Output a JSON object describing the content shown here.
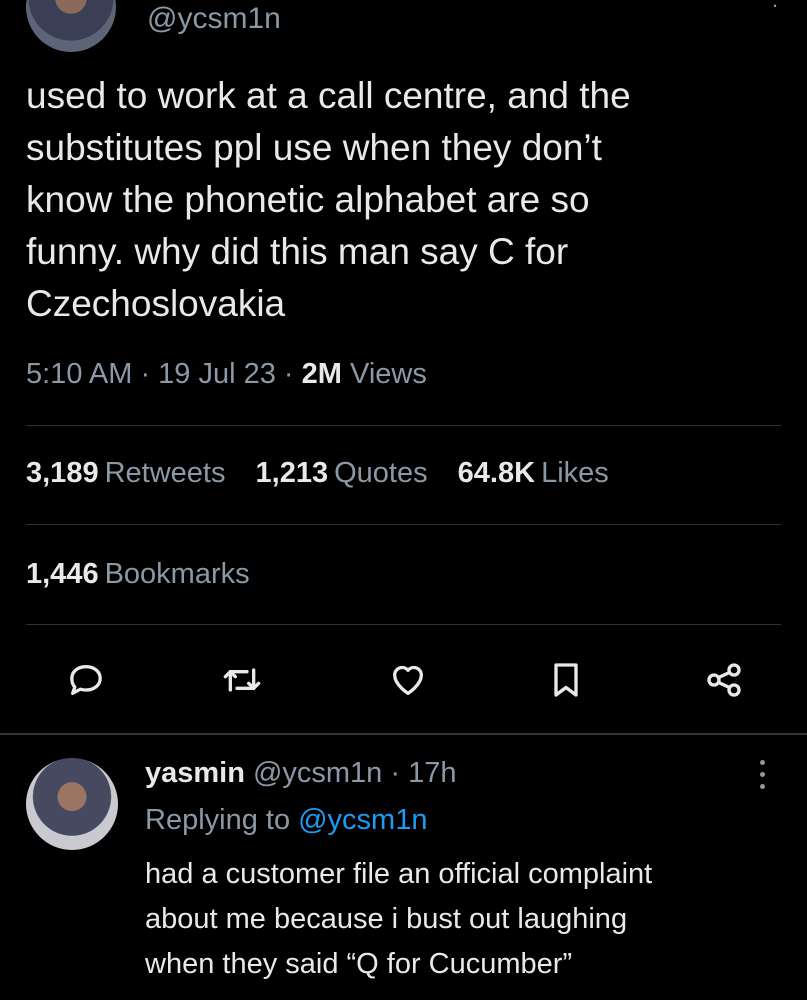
{
  "tweet": {
    "handle": "@ycsm1n",
    "text": "used to work at a call centre, and the\nsubstitutes ppl use when they don’t\nknow the phonetic alphabet are so\nfunny. why did this man say C for\nCzechoslovakia",
    "time": "5:10 AM · 19 Jul 23 · ",
    "views_count": "2M",
    "views_label": "Views"
  },
  "stats": {
    "retweets_count": "3,189",
    "retweets_label": "Retweets",
    "quotes_count": "1,213",
    "quotes_label": "Quotes",
    "likes_count": "64.8K",
    "likes_label": "Likes",
    "bookmarks_count": "1,446",
    "bookmarks_label": "Bookmarks"
  },
  "icons": {
    "reply": "reply-icon",
    "retweet": "retweet-icon",
    "like": "heart-icon",
    "bookmark": "bookmark-icon",
    "share": "share-icon"
  },
  "reply": {
    "name": "yasmin",
    "handle_time": "@ycsm1n · 17h",
    "replying_label": "Replying to",
    "replying_mention": "@ycsm1n",
    "text": "had a customer file an official complaint\nabout me because i bust out laughing\nwhen they said “Q for Cucumber”"
  },
  "colors": {
    "background": "#000000",
    "text": "#e7e9ea",
    "secondary": "#8b98a5",
    "accent": "#1d9bf0",
    "divider": "#2f3336"
  }
}
